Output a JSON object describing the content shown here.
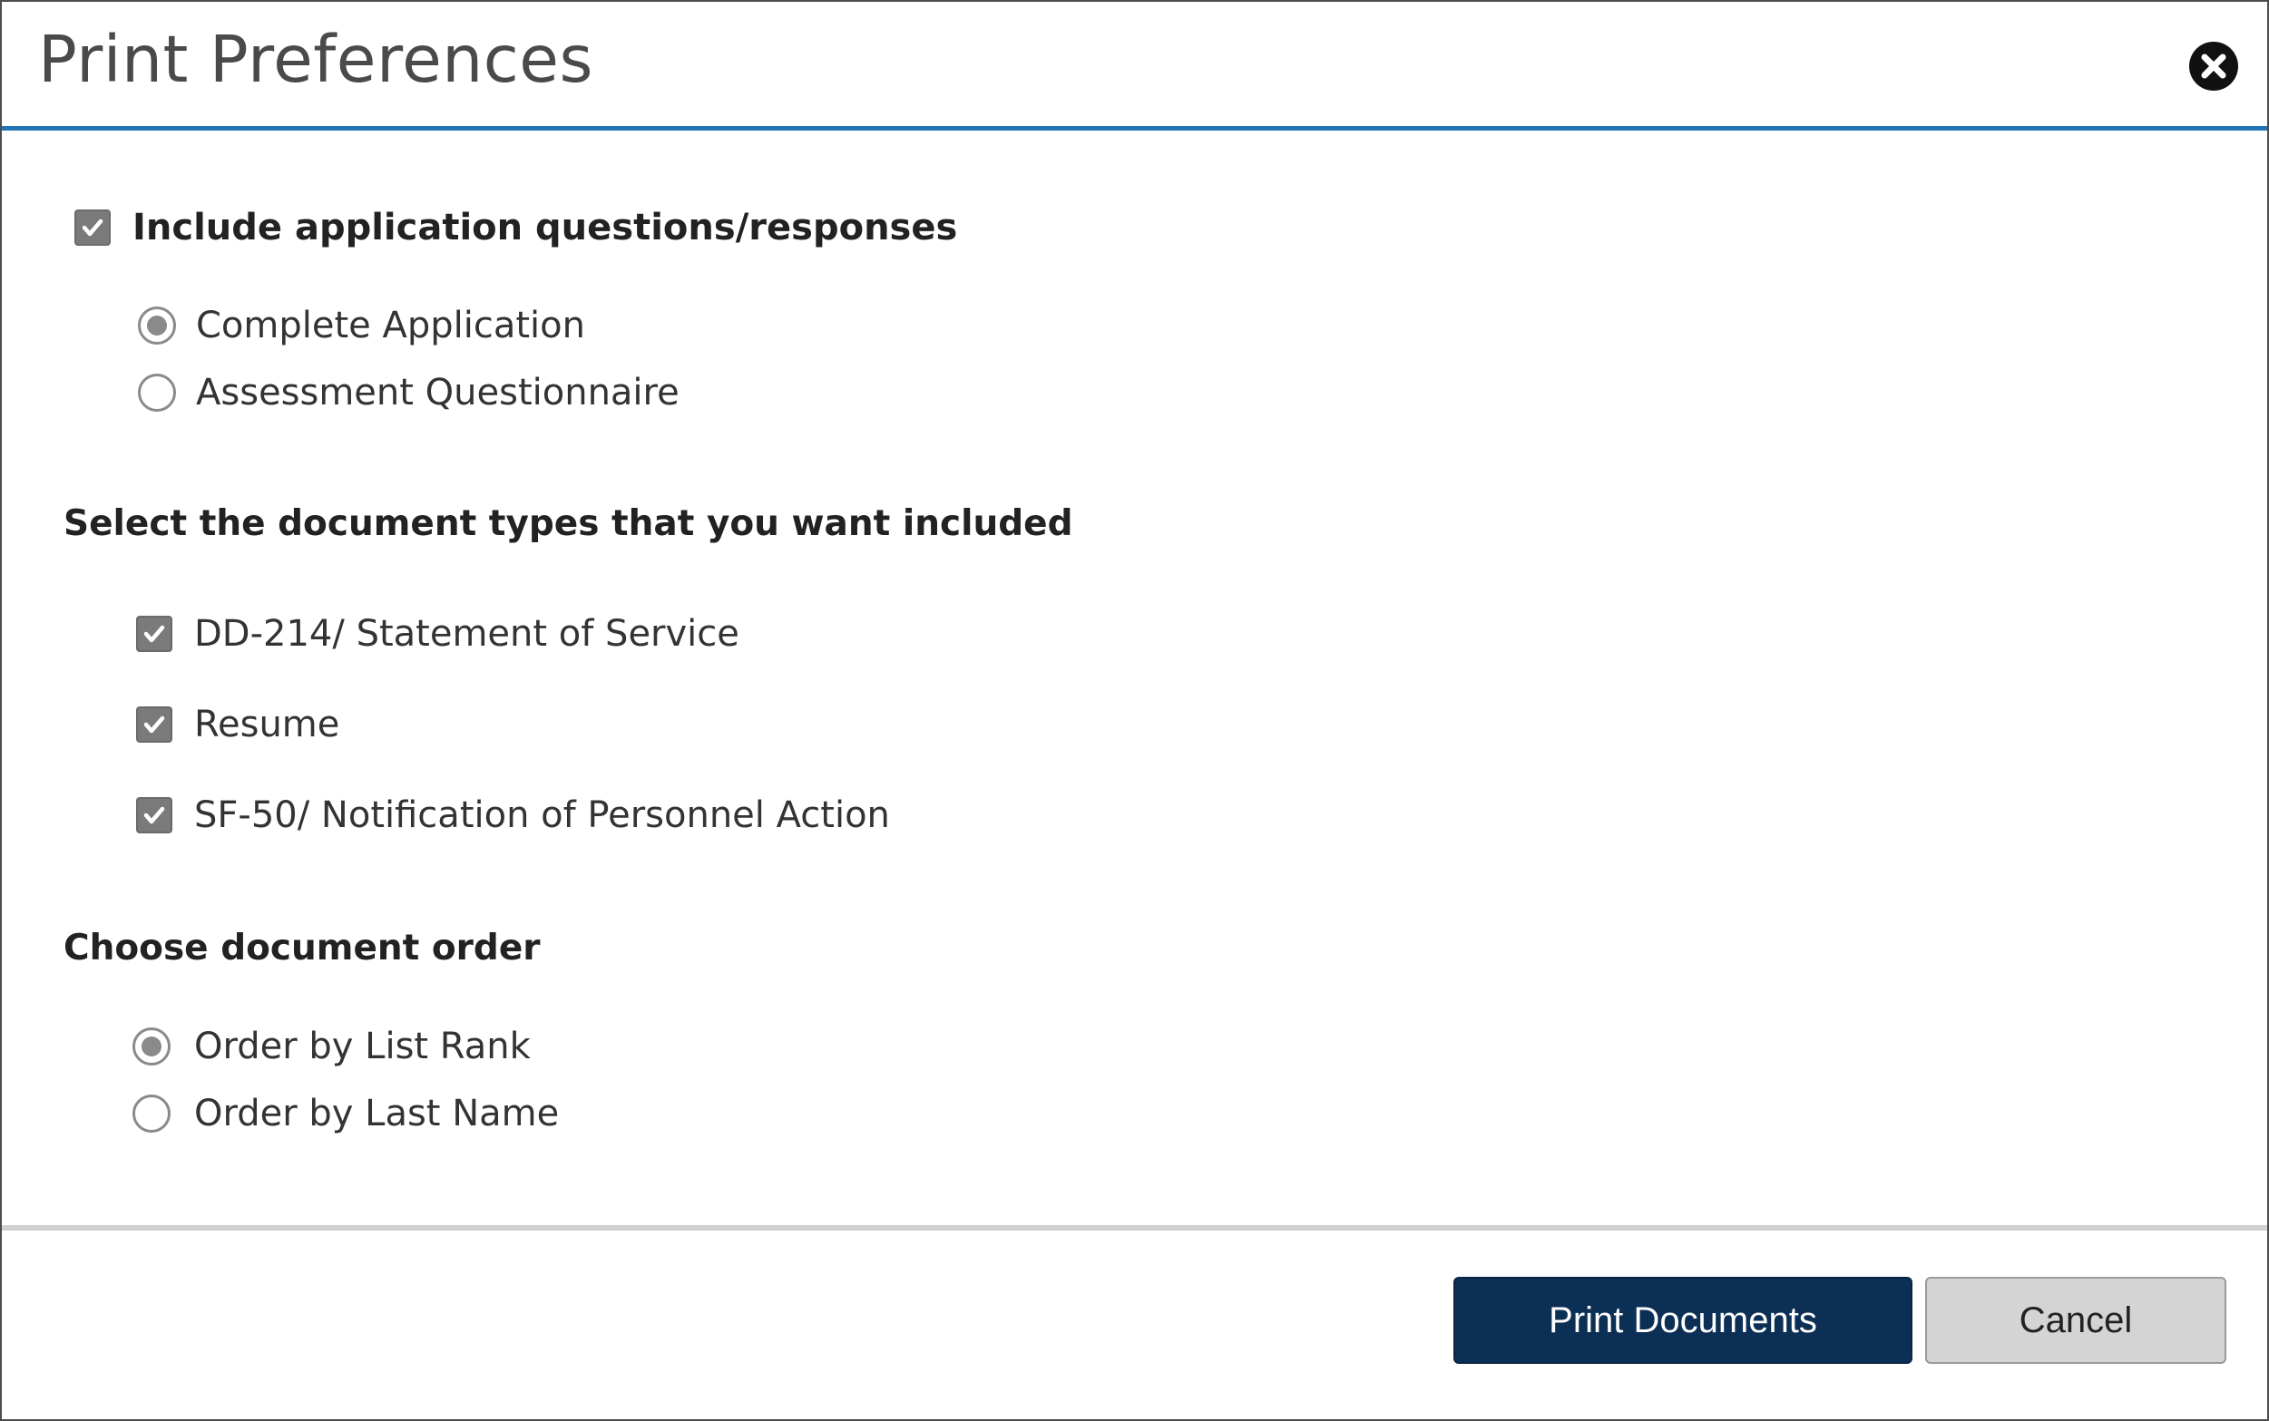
{
  "dialog": {
    "title": "Print Preferences",
    "close_icon": "close-circle-icon"
  },
  "include_questions": {
    "label": "Include application questions/responses",
    "checked": true,
    "options": [
      {
        "label": "Complete Application",
        "selected": true
      },
      {
        "label": "Assessment Questionnaire",
        "selected": false
      }
    ]
  },
  "document_types": {
    "heading": "Select the document types that you want included",
    "items": [
      {
        "label": "DD-214/ Statement of Service",
        "checked": true
      },
      {
        "label": "Resume",
        "checked": true
      },
      {
        "label": "SF-50/ Notification of Personnel Action",
        "checked": true
      }
    ]
  },
  "document_order": {
    "heading": "Choose document order",
    "options": [
      {
        "label": "Order by List Rank",
        "selected": true
      },
      {
        "label": "Order by Last Name",
        "selected": false
      }
    ]
  },
  "footer": {
    "print_label": "Print Documents",
    "cancel_label": "Cancel"
  },
  "colors": {
    "accent": "#2474b5",
    "primary_button": "#0c2f55",
    "secondary_button": "#d4d4d4"
  }
}
